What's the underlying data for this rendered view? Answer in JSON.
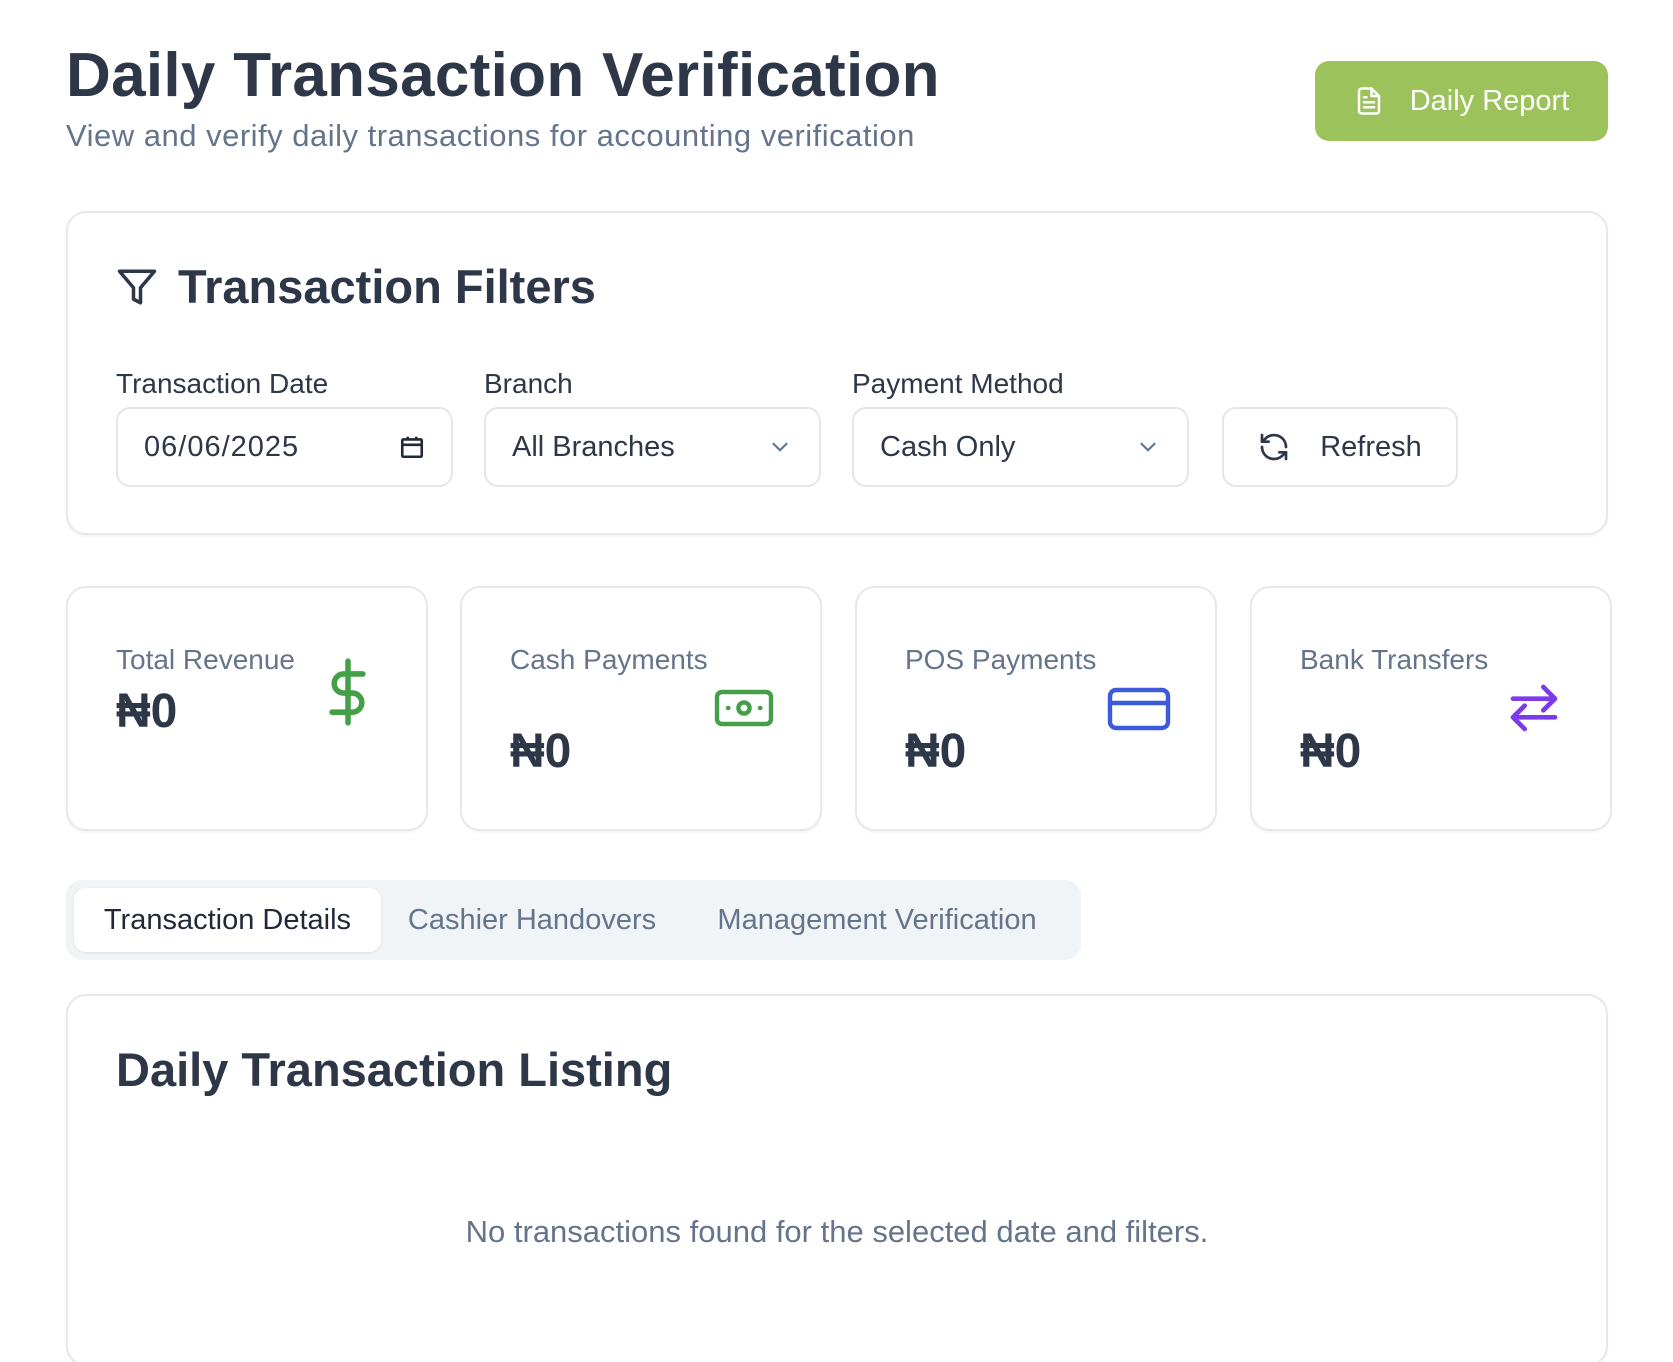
{
  "header": {
    "title": "Daily Transaction Verification",
    "subtitle": "View and verify daily transactions for accounting verification",
    "report_button": "Daily Report"
  },
  "filters": {
    "title": "Transaction Filters",
    "date_label": "Transaction Date",
    "date_value": "06/06/2025",
    "branch_label": "Branch",
    "branch_value": "All Branches",
    "payment_label": "Payment Method",
    "payment_value": "Cash Only",
    "refresh_button": "Refresh"
  },
  "stats": [
    {
      "label": "Total Revenue",
      "value": "₦0",
      "icon": "dollar-icon",
      "color": "#43a047"
    },
    {
      "label": "Cash Payments",
      "value": "₦0",
      "icon": "banknote-icon",
      "color": "#43a047"
    },
    {
      "label": "POS Payments",
      "value": "₦0",
      "icon": "credit-card-icon",
      "color": "#3b5bdb"
    },
    {
      "label": "Bank Transfers",
      "value": "₦0",
      "icon": "transfer-icon",
      "color": "#7c3aed"
    }
  ],
  "tabs": [
    {
      "label": "Transaction Details",
      "active": true
    },
    {
      "label": "Cashier Handovers",
      "active": false
    },
    {
      "label": "Management Verification",
      "active": false
    }
  ],
  "listing": {
    "title": "Daily Transaction Listing",
    "empty_message": "No transactions found for the selected date and filters."
  },
  "colors": {
    "accent": "#9bc25b",
    "text": "#2d3748",
    "muted": "#64748b"
  }
}
